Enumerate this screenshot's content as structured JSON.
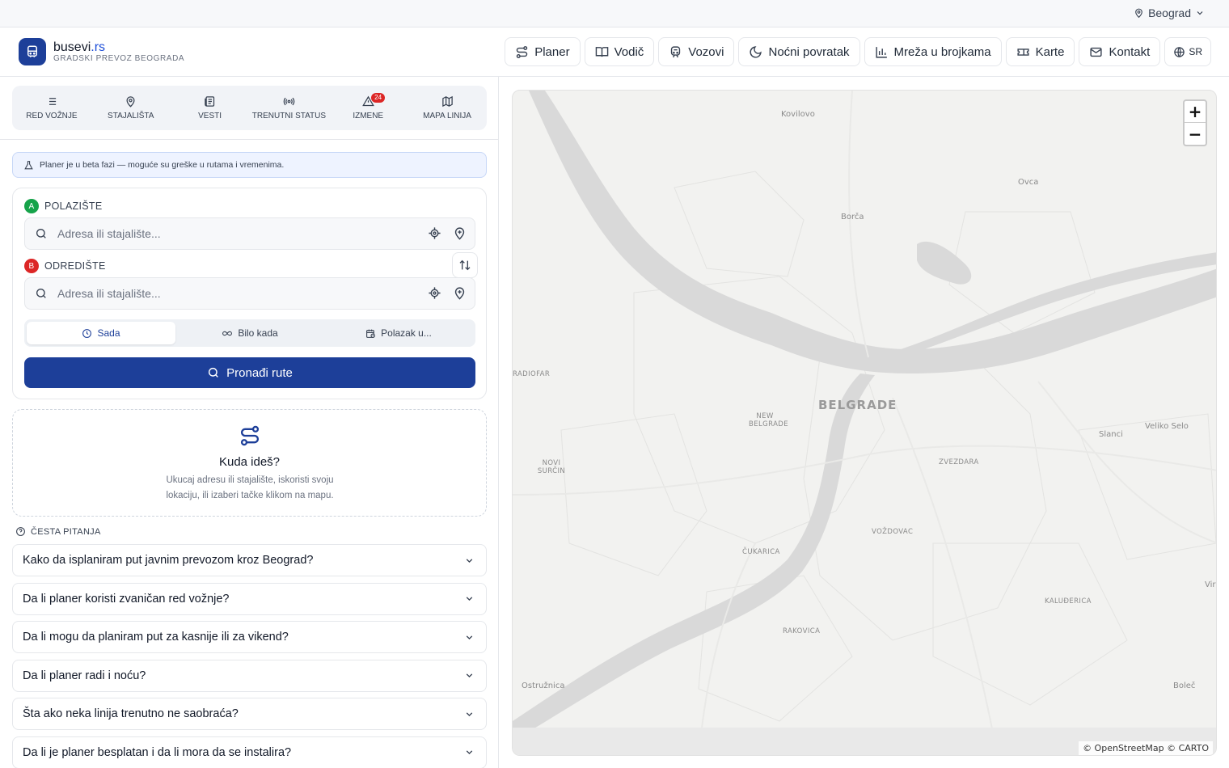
{
  "topbar": {
    "city": "Beograd"
  },
  "header": {
    "brand_name": "busevi",
    "brand_tld": ".rs",
    "tagline": "GRADSKI PREVOZ BEOGRADA",
    "nav": [
      {
        "label": "Planer",
        "icon": "route-icon"
      },
      {
        "label": "Vodič",
        "icon": "book-icon"
      },
      {
        "label": "Vozovi",
        "icon": "train-icon"
      },
      {
        "label": "Noćni povratak",
        "icon": "moon-icon"
      },
      {
        "label": "Mreža u brojkama",
        "icon": "bar-chart-icon"
      },
      {
        "label": "Karte",
        "icon": "ticket-icon"
      },
      {
        "label": "Kontakt",
        "icon": "mail-icon"
      }
    ],
    "language": "SR"
  },
  "tabs": [
    {
      "label": "RED VOŽNJE",
      "icon": "list-icon"
    },
    {
      "label": "STAJALIŠTA",
      "icon": "map-pin-icon"
    },
    {
      "label": "VESTI",
      "icon": "newspaper-icon"
    },
    {
      "label": "TRENUTNI STATUS",
      "icon": "broadcast-icon"
    },
    {
      "label": "IZMENE",
      "icon": "warning-icon",
      "badge": "24"
    },
    {
      "label": "MAPA LINIJA",
      "icon": "map-icon"
    }
  ],
  "beta_notice": "Planer je u beta fazi — moguće su greške u rutama i vremenima.",
  "planner": {
    "origin": {
      "marker": "A",
      "label": "POLAZIŠTE",
      "placeholder": "Adresa ili stajalište...",
      "value": ""
    },
    "destination": {
      "marker": "B",
      "label": "ODREDIŠTE",
      "placeholder": "Adresa ili stajalište...",
      "value": ""
    },
    "time_options": [
      "Sada",
      "Bilo kada",
      "Polazak u..."
    ],
    "selected_time_option": "Sada",
    "search_button": "Pronađi rute"
  },
  "empty_state": {
    "title": "Kuda ideš?",
    "description": "Ukucaj adresu ili stajalište, iskoristi svoju lokaciju, ili izaberi tačke klikom na mapu."
  },
  "faq": {
    "heading": "ČESTA PITANJA",
    "items": [
      "Kako da isplaniram put javnim prevozom kroz Beograd?",
      "Da li planer koristi zvaničan red vožnje?",
      "Da li mogu da planiram put za kasnije ili za vikend?",
      "Da li planer radi i noću?",
      "Šta ako neka linija trenutno ne saobraća?",
      "Da li je planer besplatan i da li mora da se instalira?"
    ]
  },
  "map": {
    "zoom_in": "+",
    "zoom_out": "−",
    "attribution": "© OpenStreetMap © CARTO",
    "places": [
      {
        "name": "Kovilovo"
      },
      {
        "name": "Ovca"
      },
      {
        "name": "Borča"
      },
      {
        "name": "RADIOFAR"
      },
      {
        "name": "BELGRADE"
      },
      {
        "name": "NEW BELGRADE"
      },
      {
        "name": "Veliko Selo"
      },
      {
        "name": "Slanci"
      },
      {
        "name": "NOVI SURČIN"
      },
      {
        "name": "ZVEZDARA"
      },
      {
        "name": "VOŽDOVAC"
      },
      {
        "name": "ČUKARICA"
      },
      {
        "name": "KALUĐERICA"
      },
      {
        "name": "RAKOVICA"
      },
      {
        "name": "Vir"
      },
      {
        "name": "Ostružnica"
      },
      {
        "name": "Boleč"
      }
    ]
  }
}
